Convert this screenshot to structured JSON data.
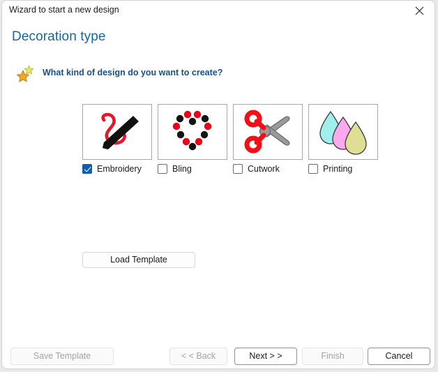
{
  "window": {
    "title": "Wizard to start a new design",
    "close_icon": "close-icon"
  },
  "heading": "Decoration type",
  "question": {
    "icon": "star-icon",
    "text": "What kind of design do you want to create?"
  },
  "options": [
    {
      "label": "Embroidery",
      "icon": "embroidery-needle-thread-icon",
      "checked": true
    },
    {
      "label": "Bling",
      "icon": "bling-heart-dots-icon",
      "checked": false
    },
    {
      "label": "Cutwork",
      "icon": "cutwork-scissors-icon",
      "checked": false
    },
    {
      "label": "Printing",
      "icon": "printing-ink-drops-icon",
      "checked": false
    }
  ],
  "load_template_label": "Load Template",
  "footer": {
    "save_template_label": "Save Template",
    "back_label": "< < Back",
    "next_label": "Next > >",
    "finish_label": "Finish",
    "cancel_label": "Cancel",
    "save_template_disabled": true,
    "back_disabled": true,
    "next_disabled": false,
    "finish_disabled": true,
    "cancel_disabled": false
  },
  "colors": {
    "heading_blue": "#16679f",
    "question_blue": "#15528c",
    "checkbox_accent": "#0f60ac",
    "embroidery_thread_red": "#e8152a",
    "embroidery_needle_black": "#111111",
    "bling_dot_red": "#ee0016",
    "bling_dot_black": "#141414",
    "scissor_handle_red": "#f40e15",
    "scissor_blade_gray": "#9a9a9a",
    "drop_cyan": "#9ff0ec",
    "drop_pink": "#fba9ee",
    "drop_khaki": "#dede94",
    "star_gold": "#f5a623",
    "star_yellow": "#e8e84a"
  }
}
